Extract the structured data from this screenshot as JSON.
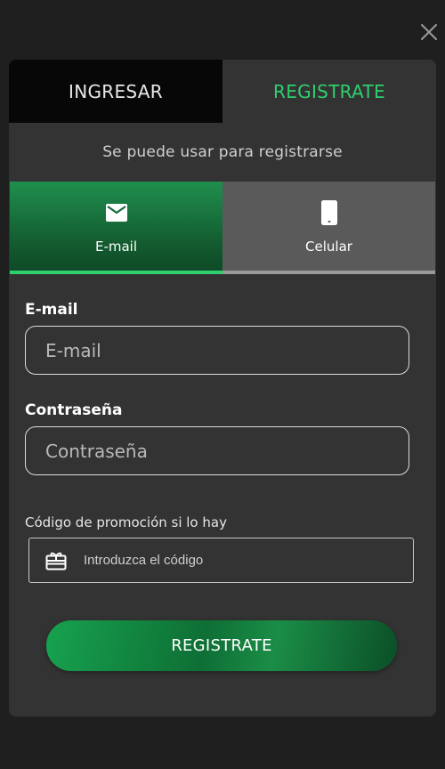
{
  "colors": {
    "accent": "#2ed06e",
    "background": "#1f1f1f",
    "modal": "#333333",
    "login_tab": "#070707",
    "phone_tab": "#5a5a5a"
  },
  "close_icon": "close-icon",
  "top_tabs": {
    "login_label": "INGRESAR",
    "register_label": "REGISTRATE",
    "active": "register"
  },
  "hint_text": "Se puede usar para registrarse",
  "method_tabs": {
    "active": "email",
    "email": {
      "label": "E-mail",
      "icon": "envelope-icon"
    },
    "phone": {
      "label": "Celular",
      "icon": "smartphone-icon"
    }
  },
  "form": {
    "email_label": "E-mail",
    "email_placeholder": "E-mail",
    "email_value": "",
    "password_label": "Contraseña",
    "password_placeholder": "Contraseña",
    "password_value": "",
    "promo_label": "Código de promoción si lo hay",
    "promo_placeholder": "Introduzca el código",
    "promo_value": "",
    "promo_icon": "gift-card-icon",
    "submit_label": "REGISTRATE"
  }
}
